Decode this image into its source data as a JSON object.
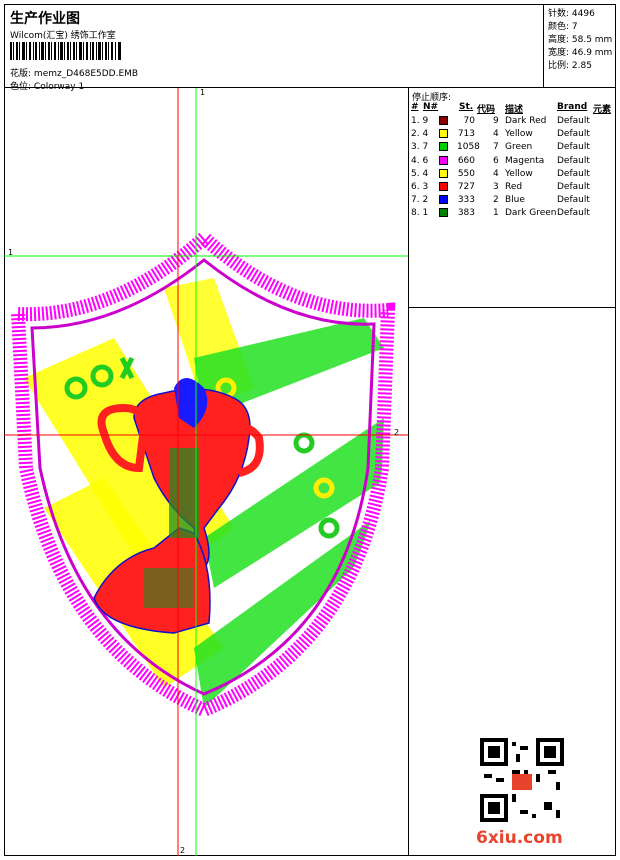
{
  "header": {
    "title": "生产作业图",
    "company": "Wilcom(汇宝) 绣饰工作室",
    "design_label": "花版:",
    "design_value": "memz_D468E5DD.EMB",
    "colorway_label": "色位:",
    "colorway_value": "Colorway 1"
  },
  "stats": {
    "stitches": "针数: 4496",
    "colors": "颜色: 7",
    "height": "高度: 58.5 mm",
    "width": "宽度: 46.9 mm",
    "scale": "比例: 2.85"
  },
  "stop_sequence": {
    "title": "停止顺序:",
    "headers": [
      "#",
      "N#",
      "St.",
      "代码",
      "描述",
      "Brand",
      "元素"
    ],
    "rows": [
      {
        "seq": "1. 9",
        "color": "#8b0000",
        "stitches": "70",
        "code": "9",
        "desc": "Dark Red",
        "brand": "Default"
      },
      {
        "seq": "2. 4",
        "color": "#ffff00",
        "stitches": "713",
        "code": "4",
        "desc": "Yellow",
        "brand": "Default"
      },
      {
        "seq": "3. 7",
        "color": "#00d000",
        "stitches": "1058",
        "code": "7",
        "desc": "Green",
        "brand": "Default"
      },
      {
        "seq": "4. 6",
        "color": "#ff00ff",
        "stitches": "660",
        "code": "6",
        "desc": "Magenta",
        "brand": "Default"
      },
      {
        "seq": "5. 4",
        "color": "#ffff00",
        "stitches": "550",
        "code": "4",
        "desc": "Yellow",
        "brand": "Default"
      },
      {
        "seq": "6. 3",
        "color": "#ff0000",
        "stitches": "727",
        "code": "3",
        "desc": "Red",
        "brand": "Default"
      },
      {
        "seq": "7. 2",
        "color": "#0000ff",
        "stitches": "333",
        "code": "2",
        "desc": "Blue",
        "brand": "Default"
      },
      {
        "seq": "8. 1",
        "color": "#008000",
        "stitches": "383",
        "code": "1",
        "desc": "Dark Green",
        "brand": "Default"
      }
    ]
  },
  "guides": {
    "label_1": "1",
    "label_2": "2"
  },
  "watermark": "6xiu.com",
  "colors": {
    "guide_green": "#00ff00",
    "guide_red": "#ff0000",
    "magenta": "#ff00ff",
    "yellow": "#ffff00",
    "green": "#00d000",
    "red": "#ff0000",
    "blue": "#0000ff",
    "dark_green": "#008000"
  }
}
